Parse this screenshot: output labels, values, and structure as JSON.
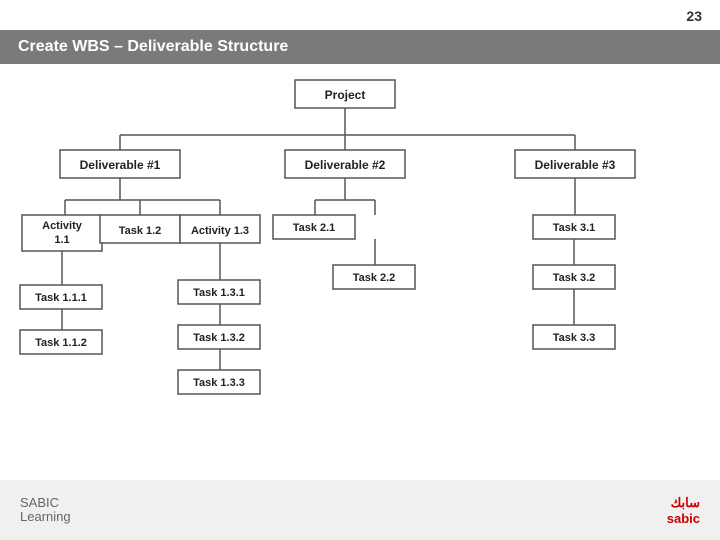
{
  "page": {
    "number": "23",
    "header": "Create WBS – Deliverable Structure"
  },
  "tree": {
    "root": "Project",
    "level1": [
      {
        "label": "Deliverable #1"
      },
      {
        "label": "Deliverable #2"
      },
      {
        "label": "Deliverable #3"
      }
    ],
    "level2_d1": [
      {
        "label": "Activity\n1.1"
      },
      {
        "label": "Task 1.2"
      },
      {
        "label": "Activity 1.3"
      }
    ],
    "level3_d1": [
      {
        "label": "Task 1.1.1"
      },
      {
        "label": "Task 1.1.2"
      },
      {
        "label": "Task 1.3.1"
      },
      {
        "label": "Task 1.3.2"
      },
      {
        "label": "Task 1.3.3"
      }
    ],
    "level2_d2": [
      {
        "label": "Task 2.1"
      },
      {
        "label": "Task 2.2"
      }
    ],
    "level2_d3": [
      {
        "label": "Task 3.1"
      },
      {
        "label": "Task 3.2"
      },
      {
        "label": "Task 3.3"
      }
    ]
  },
  "footer": {
    "left_line1": "SABIC",
    "left_line2": "Learning",
    "right_line1": "سابك",
    "right_line2": "sabic"
  }
}
